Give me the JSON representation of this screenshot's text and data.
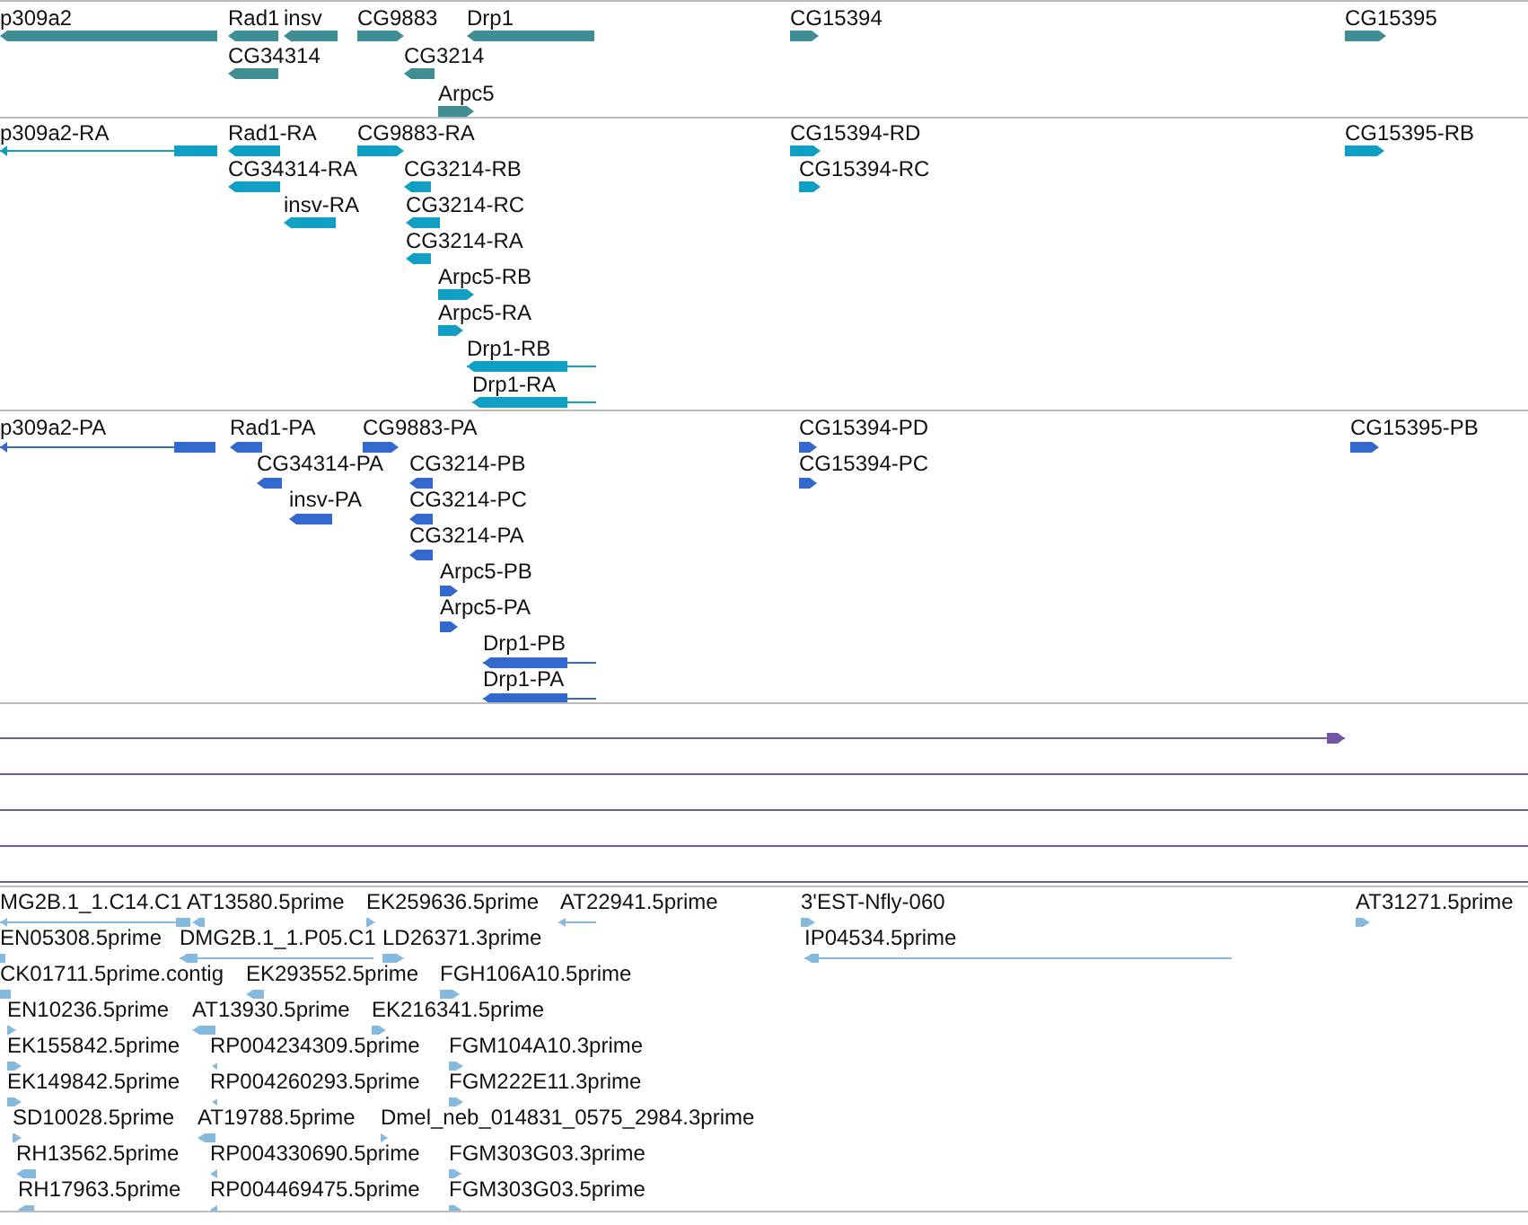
{
  "tracks": [
    {
      "features": [
        {
          "label": "p309a2",
          "reverse": true
        },
        {
          "label": "Rad1",
          "reverse": true
        },
        {
          "label": "insv",
          "reverse": true
        },
        {
          "label": "CG9883",
          "reverse": false
        },
        {
          "label": "Drp1",
          "reverse": true
        },
        {
          "label": "CG34314",
          "reverse": true
        },
        {
          "label": "CG3214",
          "reverse": true
        },
        {
          "label": "Arpc5",
          "reverse": false
        },
        {
          "label": "CG15394",
          "reverse": false
        },
        {
          "label": "CG15395",
          "reverse": false
        }
      ]
    },
    {
      "features": [
        {
          "label": "p309a2-RA",
          "reverse": true
        },
        {
          "label": "Rad1-RA",
          "reverse": true
        },
        {
          "label": "CG9883-RA",
          "reverse": false
        },
        {
          "label": "CG15394-RD",
          "reverse": false
        },
        {
          "label": "CG15395-RB",
          "reverse": false
        },
        {
          "label": "CG34314-RA",
          "reverse": true
        },
        {
          "label": "CG3214-RB",
          "reverse": true
        },
        {
          "label": "CG15394-RC",
          "reverse": false
        },
        {
          "label": "insv-RA",
          "reverse": true
        },
        {
          "label": "CG3214-RC",
          "reverse": true
        },
        {
          "label": "CG3214-RA",
          "reverse": true
        },
        {
          "label": "Arpc5-RB",
          "reverse": false
        },
        {
          "label": "Arpc5-RA",
          "reverse": false
        },
        {
          "label": "Drp1-RB",
          "reverse": true
        },
        {
          "label": "Drp1-RA",
          "reverse": true
        }
      ]
    },
    {
      "features": [
        {
          "label": "p309a2-PA",
          "reverse": true
        },
        {
          "label": "Rad1-PA",
          "reverse": true
        },
        {
          "label": "CG9883-PA",
          "reverse": false
        },
        {
          "label": "CG15394-PD",
          "reverse": false
        },
        {
          "label": "CG15395-PB",
          "reverse": false
        },
        {
          "label": "CG34314-PA",
          "reverse": true
        },
        {
          "label": "CG3214-PB",
          "reverse": true
        },
        {
          "label": "CG15394-PC",
          "reverse": false
        },
        {
          "label": "insv-PA",
          "reverse": true
        },
        {
          "label": "CG3214-PC",
          "reverse": true
        },
        {
          "label": "CG3214-PA",
          "reverse": true
        },
        {
          "label": "Arpc5-PB",
          "reverse": false
        },
        {
          "label": "Arpc5-PA",
          "reverse": false
        },
        {
          "label": "Drp1-PB",
          "reverse": true
        },
        {
          "label": "Drp1-PA",
          "reverse": true
        }
      ]
    },
    {
      "features": [
        {
          "kind": "arrow",
          "reverse": false
        },
        {
          "kind": "span"
        },
        {
          "kind": "span"
        },
        {
          "kind": "span"
        },
        {
          "kind": "span"
        }
      ]
    },
    {
      "features": [
        {
          "label": "MG2B.1_1.C14.C1",
          "reverse": true
        },
        {
          "label": "AT13580.5prime",
          "reverse": true
        },
        {
          "label": "EK259636.5prime",
          "reverse": false
        },
        {
          "label": "AT22941.5prime",
          "reverse": true
        },
        {
          "label": "3'EST-Nfly-060",
          "reverse": false
        },
        {
          "label": "AT31271.5prime",
          "reverse": false
        },
        {
          "label": "EN05308.5prime"
        },
        {
          "label": "DMG2B.1_1.P05.C1",
          "reverse": true
        },
        {
          "label": "LD26371.3prime",
          "reverse": false
        },
        {
          "label": "IP04534.5prime",
          "reverse": true
        },
        {
          "label": "CK01711.5prime.contig"
        },
        {
          "label": "EK293552.5prime",
          "reverse": true
        },
        {
          "label": "FGH106A10.5prime",
          "reverse": false
        },
        {
          "label": "EN10236.5prime",
          "reverse": false
        },
        {
          "label": "AT13930.5prime",
          "reverse": true
        },
        {
          "label": "EK216341.5prime",
          "reverse": false
        },
        {
          "label": "EK155842.5prime",
          "reverse": false
        },
        {
          "label": "RP004234309.5prime",
          "reverse": true
        },
        {
          "label": "FGM104A10.3prime",
          "reverse": false
        },
        {
          "label": "EK149842.5prime",
          "reverse": false
        },
        {
          "label": "RP004260293.5prime",
          "reverse": true
        },
        {
          "label": "FGM222E11.3prime",
          "reverse": false
        },
        {
          "label": "SD10028.5prime",
          "reverse": false
        },
        {
          "label": "AT19788.5prime",
          "reverse": true
        },
        {
          "label": "Dmel_neb_014831_0575_2984.3prime",
          "reverse": false
        },
        {
          "label": "RH13562.5prime",
          "reverse": true
        },
        {
          "label": "RP004330690.5prime",
          "reverse": true
        },
        {
          "label": "FGM303G03.3prime",
          "reverse": false
        },
        {
          "label": "RH17963.5prime",
          "reverse": true
        },
        {
          "label": "RP004469475.5prime",
          "reverse": true
        },
        {
          "label": "FGM303G03.5prime",
          "reverse": false
        }
      ]
    }
  ]
}
